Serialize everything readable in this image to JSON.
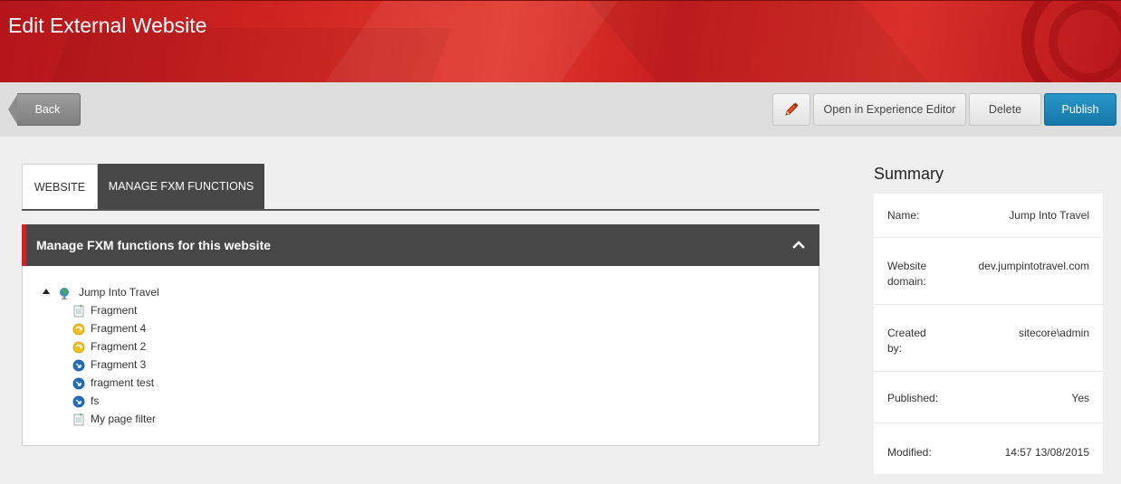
{
  "header": {
    "title": "Edit External Website"
  },
  "toolbar": {
    "back_label": "Back",
    "edit_icon": "pencil-icon",
    "experience_editor_label": "Open in Experience Editor",
    "delete_label": "Delete",
    "publish_label": "Publish"
  },
  "tabs": [
    {
      "label": "WEBSITE",
      "active": false
    },
    {
      "label": "MANAGE FXM FUNCTIONS",
      "active": true
    }
  ],
  "panel": {
    "title": "Manage FXM functions for this website",
    "tree": {
      "root": {
        "label": "Jump Into Travel",
        "icon": "globe-icon",
        "expanded": true
      },
      "children": [
        {
          "label": "Fragment",
          "icon": "page-icon"
        },
        {
          "label": "Fragment 4",
          "icon": "yellow-arrow-icon"
        },
        {
          "label": "Fragment 2",
          "icon": "yellow-arrow-icon"
        },
        {
          "label": "Fragment 3",
          "icon": "blue-arrow-icon"
        },
        {
          "label": "fragment test",
          "icon": "blue-arrow-icon"
        },
        {
          "label": "fs",
          "icon": "blue-arrow-icon"
        },
        {
          "label": "My page filter",
          "icon": "page-icon"
        }
      ]
    }
  },
  "summary": {
    "title": "Summary",
    "rows": [
      {
        "key": "Name:",
        "value": "Jump Into Travel"
      },
      {
        "key": "Website domain:",
        "value": "dev.jumpintotravel.com"
      },
      {
        "key": "Created by:",
        "value": "sitecore\\admin"
      },
      {
        "key": "Published:",
        "value": "Yes"
      },
      {
        "key": "Modified:",
        "value": "14:57 13/08/2015"
      }
    ]
  },
  "colors": {
    "header_red": "#d32025",
    "publish_blue": "#1f87bb",
    "dark_panel": "#474747"
  }
}
